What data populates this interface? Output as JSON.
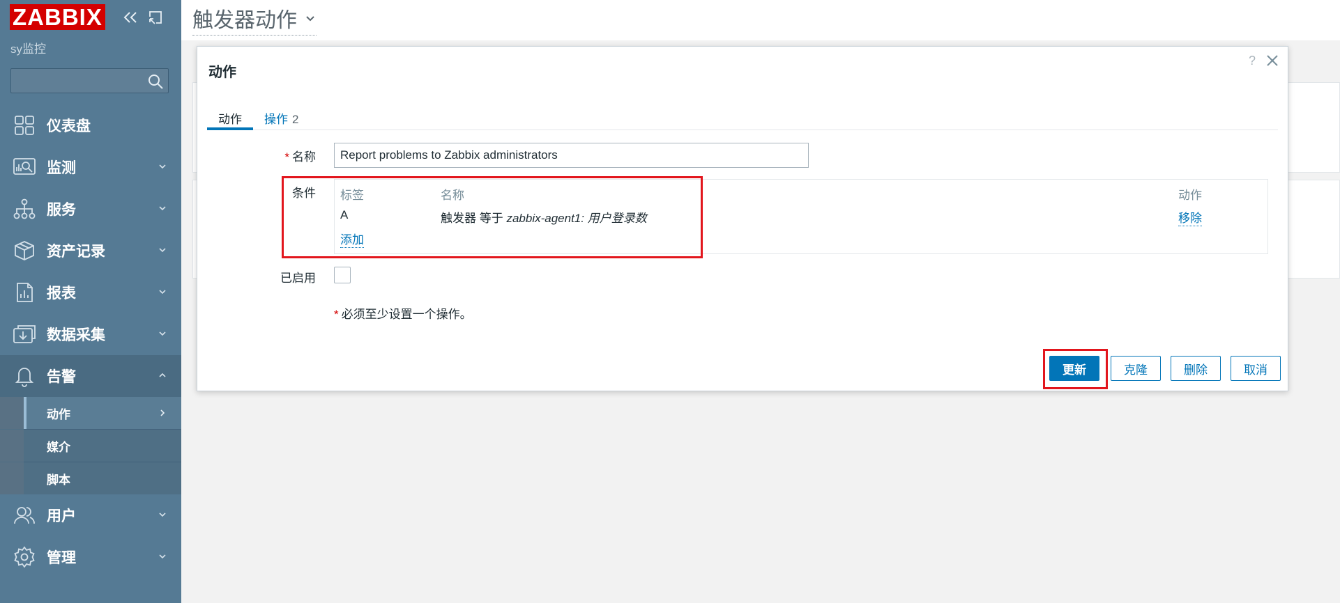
{
  "app": {
    "logo": "ZABBIX",
    "server_name": "sy监控",
    "search_placeholder": ""
  },
  "sidebar": {
    "items": [
      {
        "label": "仪表盘",
        "icon": "dashboard-icon"
      },
      {
        "label": "监测",
        "icon": "monitoring-icon"
      },
      {
        "label": "服务",
        "icon": "services-icon"
      },
      {
        "label": "资产记录",
        "icon": "inventory-icon"
      },
      {
        "label": "报表",
        "icon": "reports-icon"
      },
      {
        "label": "数据采集",
        "icon": "data-collection-icon"
      },
      {
        "label": "告警",
        "icon": "alerts-bell-icon"
      },
      {
        "label": "用户",
        "icon": "users-icon"
      },
      {
        "label": "管理",
        "icon": "administration-gear-icon"
      }
    ],
    "alerts_submenu": [
      {
        "label": "动作",
        "active": true
      },
      {
        "label": "媒介",
        "active": false
      },
      {
        "label": "脚本",
        "active": false
      }
    ]
  },
  "header": {
    "title": "触发器动作"
  },
  "dialog": {
    "title": "动作",
    "help": "?",
    "tabs": [
      {
        "label": "动作",
        "active": true
      },
      {
        "label": "操作",
        "count": "2",
        "active": false
      }
    ],
    "name_label": "名称",
    "name_value": "Report problems to Zabbix administrators",
    "conditions_label": "条件",
    "conditions_table": {
      "headers": {
        "tag": "标签",
        "name": "名称",
        "action": "动作"
      },
      "rows": [
        {
          "tag": "A",
          "name_prefix": "触发器 等于 ",
          "name_value": "zabbix-agent1: 用户登录数",
          "action": "移除"
        }
      ],
      "add_link": "添加"
    },
    "enabled_label": "已启用",
    "enabled": false,
    "required_note": "必须至少设置一个操作。",
    "required_marker": "*",
    "buttons": {
      "update": "更新",
      "clone": "克隆",
      "delete": "删除",
      "cancel": "取消"
    }
  },
  "colors": {
    "sidebar_bg": "#557a94",
    "logo_bg": "#d40000",
    "accent": "#0275b8",
    "highlight": "#e2161d"
  }
}
